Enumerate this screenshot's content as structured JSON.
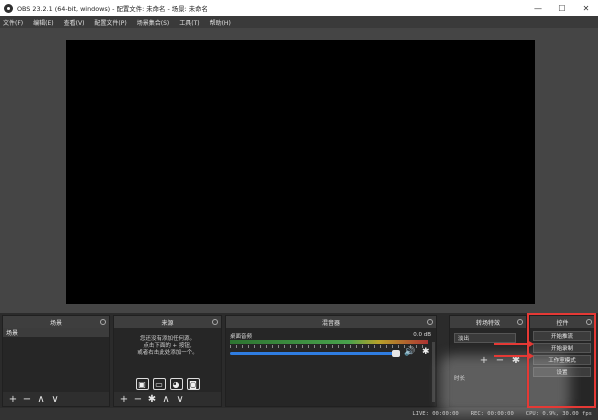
{
  "window": {
    "title": "OBS 23.2.1 (64-bit, windows) - 配置文件: 未命名 - 场景: 未命名",
    "minimize": "—",
    "maximize": "☐",
    "close": "✕"
  },
  "menu": [
    "文件(F)",
    "编辑(E)",
    "查看(V)",
    "配置文件(P)",
    "场景集合(S)",
    "工具(T)",
    "帮助(H)"
  ],
  "docks": {
    "scenes": {
      "title": "场景",
      "items": [
        "场景"
      ]
    },
    "sources": {
      "title": "来源",
      "hint": [
        "您还没有添加任何源。",
        "点击下面的 + 按钮,",
        "或者右击此处添加一个。"
      ]
    },
    "mixer": {
      "title": "混音器",
      "track_name": "桌面音频",
      "track_db": "0.0 dB"
    },
    "transitions": {
      "title": "转场特效",
      "selected": "淡出",
      "duration_label": "时长"
    },
    "controls": {
      "title": "控件",
      "buttons": [
        "开始推流",
        "开始录制",
        "工作室模式",
        "设置"
      ]
    }
  },
  "tools": {
    "add": "+",
    "remove": "−",
    "up": "∧",
    "down": "∨",
    "gear": "✱"
  },
  "source_icons": [
    "▣",
    "▭",
    "◕",
    "◙"
  ],
  "status": {
    "live": "LIVE: 00:00:00",
    "rec": "REC: 00:00:00",
    "cpu": "CPU: 0.9%, 30.00 fps"
  },
  "colors": {
    "accent_blue": "#2f7de1",
    "annotation_red": "#e53935"
  }
}
